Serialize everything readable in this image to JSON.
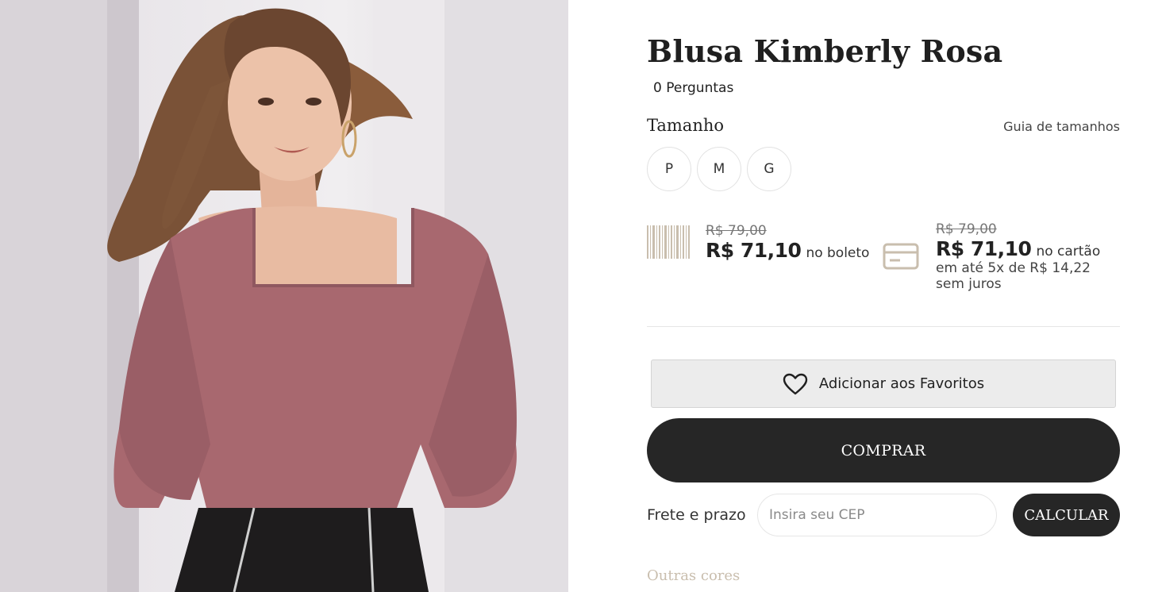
{
  "product": {
    "title": "Blusa Kimberly Rosa",
    "questions": "0 Perguntas",
    "image_alt": "Modelo vestindo blusa rosa de mangas bufantes"
  },
  "size": {
    "label": "Tamanho",
    "guide_link": "Guia de tamanhos",
    "options": [
      "P",
      "M",
      "G"
    ]
  },
  "pricing": {
    "boleto": {
      "old_price": "R$ 79,00",
      "price": "R$ 71,10",
      "suffix": "no boleto",
      "icon": "barcode-icon"
    },
    "card": {
      "old_price": "R$ 79,00",
      "price": "R$ 71,10",
      "suffix": "no cartão",
      "installments": "em até 5x de R$ 14,22 sem juros",
      "icon": "credit-card-icon"
    }
  },
  "actions": {
    "favorite_label": "Adicionar aos Favoritos",
    "favorite_icon": "heart-icon",
    "buy_label": "COMPRAR"
  },
  "shipping": {
    "label": "Frete e prazo",
    "cep_placeholder": "Insira seu CEP",
    "calculate_label": "CALCULAR"
  },
  "other_colors_label": "Outras cores",
  "colors": {
    "dark": "#262626",
    "accent_beige": "#c9beae",
    "blouse_pink": "#a8686f",
    "divider": "#e6e6e6"
  }
}
